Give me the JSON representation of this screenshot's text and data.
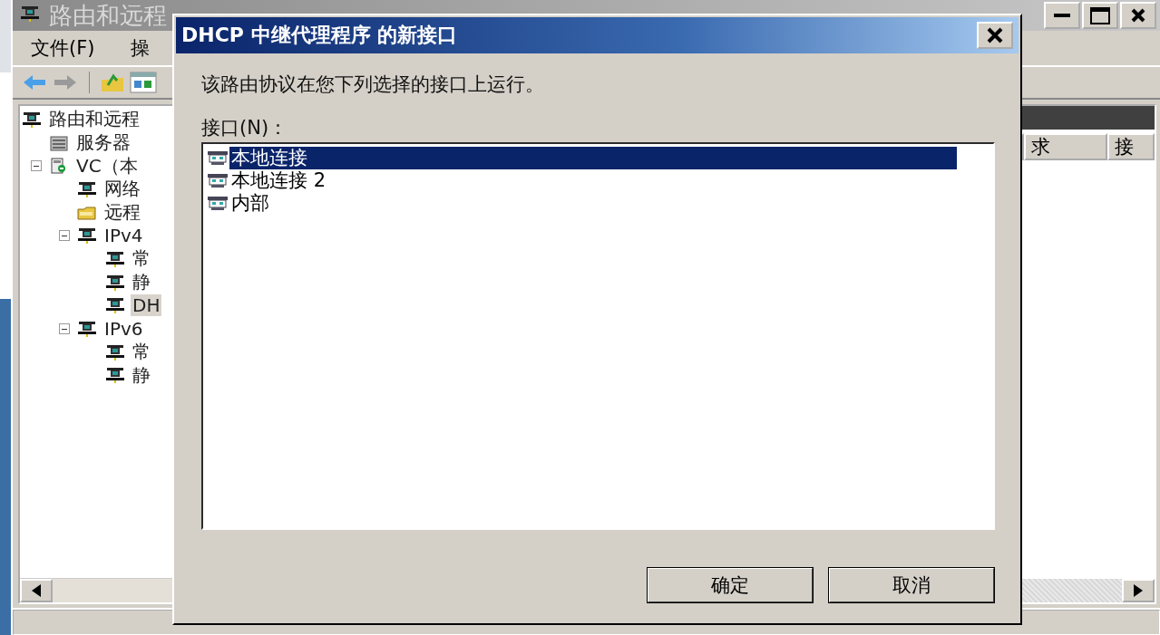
{
  "main_window": {
    "title": "路由和远程",
    "menu": [
      "文件(F)",
      "操"
    ],
    "tree": [
      {
        "label": "路由和远程",
        "kind": "network",
        "selected": false,
        "children": [
          {
            "label": "服务器",
            "kind": "server",
            "selected": false
          },
          {
            "label": "VC（本",
            "kind": "computer",
            "selected": false,
            "expanded": true,
            "children": [
              {
                "label": "网络",
                "kind": "network",
                "selected": false
              },
              {
                "label": "远程",
                "kind": "folder",
                "selected": false
              },
              {
                "label": "IPv4",
                "kind": "network",
                "selected": false,
                "expanded": true,
                "children": [
                  {
                    "label": "常",
                    "kind": "network",
                    "selected": false
                  },
                  {
                    "label": "静",
                    "kind": "network",
                    "selected": false
                  },
                  {
                    "label": "DH",
                    "kind": "network",
                    "selected": true
                  }
                ]
              },
              {
                "label": "IPv6",
                "kind": "network",
                "selected": false,
                "expanded": true,
                "children": [
                  {
                    "label": "常",
                    "kind": "network",
                    "selected": false
                  },
                  {
                    "label": "静",
                    "kind": "network",
                    "selected": false
                  }
                ]
              }
            ]
          }
        ]
      }
    ],
    "columns": [
      "求",
      "接"
    ]
  },
  "dialog": {
    "title": "DHCP 中继代理程序 的新接口",
    "prompt": "该路由协议在您下列选择的接口上运行。",
    "list_label": "接口(N)：",
    "interfaces": [
      {
        "label": "本地连接",
        "selected": true
      },
      {
        "label": "本地连接 2",
        "selected": false
      },
      {
        "label": "内部",
        "selected": false
      }
    ],
    "buttons": [
      "确定",
      "取消"
    ]
  }
}
